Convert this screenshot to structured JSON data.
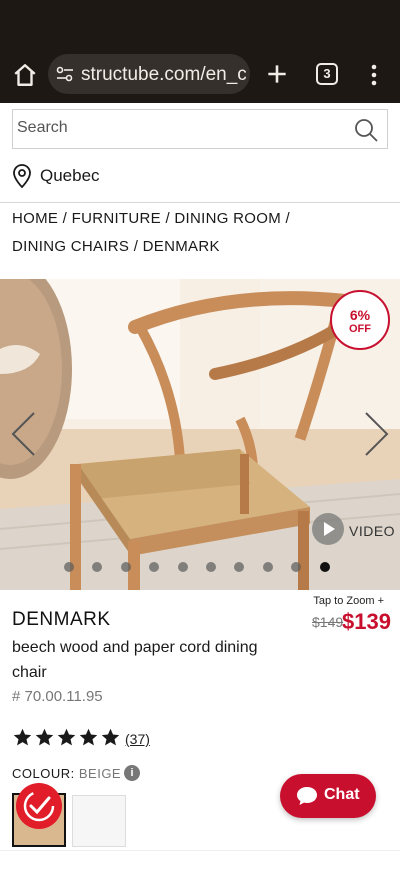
{
  "browser": {
    "url": "structube.com/en_c",
    "tab_count": "3"
  },
  "search": {
    "placeholder": "Search"
  },
  "location": {
    "label": "Quebec"
  },
  "breadcrumbs": [
    "HOME",
    "FURNITURE",
    "DINING ROOM",
    "DINING CHAIRS",
    "DENMARK"
  ],
  "gallery": {
    "badge_pct": "6%",
    "badge_off": "OFF",
    "video_label": "VIDEO",
    "slide_count": 10,
    "active_slide": 10
  },
  "product": {
    "name": "DENMARK",
    "description": "beech wood and paper cord dining chair",
    "sku": "# 70.00.11.95",
    "tap_to_zoom": "Tap to Zoom +",
    "price_old": "$149",
    "price_new": "$139",
    "rating": 5,
    "review_count": "(37)",
    "colour_label": "COLOUR:",
    "colour_value": "BEIGE"
  },
  "chat": {
    "label": "Chat"
  },
  "colors": {
    "brand_red": "#c8102e",
    "browser_bg": "#1e1814"
  }
}
